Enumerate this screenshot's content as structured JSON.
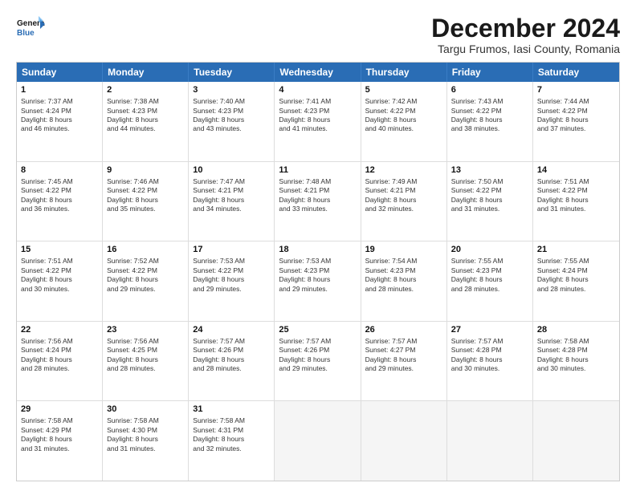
{
  "header": {
    "logo_line1": "General",
    "logo_line2": "Blue",
    "title": "December 2024",
    "subtitle": "Targu Frumos, Iasi County, Romania"
  },
  "days": [
    "Sunday",
    "Monday",
    "Tuesday",
    "Wednesday",
    "Thursday",
    "Friday",
    "Saturday"
  ],
  "rows": [
    [
      {
        "day": "1",
        "info": "Sunrise: 7:37 AM\nSunset: 4:24 PM\nDaylight: 8 hours\nand 46 minutes."
      },
      {
        "day": "2",
        "info": "Sunrise: 7:38 AM\nSunset: 4:23 PM\nDaylight: 8 hours\nand 44 minutes."
      },
      {
        "day": "3",
        "info": "Sunrise: 7:40 AM\nSunset: 4:23 PM\nDaylight: 8 hours\nand 43 minutes."
      },
      {
        "day": "4",
        "info": "Sunrise: 7:41 AM\nSunset: 4:23 PM\nDaylight: 8 hours\nand 41 minutes."
      },
      {
        "day": "5",
        "info": "Sunrise: 7:42 AM\nSunset: 4:22 PM\nDaylight: 8 hours\nand 40 minutes."
      },
      {
        "day": "6",
        "info": "Sunrise: 7:43 AM\nSunset: 4:22 PM\nDaylight: 8 hours\nand 38 minutes."
      },
      {
        "day": "7",
        "info": "Sunrise: 7:44 AM\nSunset: 4:22 PM\nDaylight: 8 hours\nand 37 minutes."
      }
    ],
    [
      {
        "day": "8",
        "info": "Sunrise: 7:45 AM\nSunset: 4:22 PM\nDaylight: 8 hours\nand 36 minutes."
      },
      {
        "day": "9",
        "info": "Sunrise: 7:46 AM\nSunset: 4:22 PM\nDaylight: 8 hours\nand 35 minutes."
      },
      {
        "day": "10",
        "info": "Sunrise: 7:47 AM\nSunset: 4:21 PM\nDaylight: 8 hours\nand 34 minutes."
      },
      {
        "day": "11",
        "info": "Sunrise: 7:48 AM\nSunset: 4:21 PM\nDaylight: 8 hours\nand 33 minutes."
      },
      {
        "day": "12",
        "info": "Sunrise: 7:49 AM\nSunset: 4:21 PM\nDaylight: 8 hours\nand 32 minutes."
      },
      {
        "day": "13",
        "info": "Sunrise: 7:50 AM\nSunset: 4:22 PM\nDaylight: 8 hours\nand 31 minutes."
      },
      {
        "day": "14",
        "info": "Sunrise: 7:51 AM\nSunset: 4:22 PM\nDaylight: 8 hours\nand 31 minutes."
      }
    ],
    [
      {
        "day": "15",
        "info": "Sunrise: 7:51 AM\nSunset: 4:22 PM\nDaylight: 8 hours\nand 30 minutes."
      },
      {
        "day": "16",
        "info": "Sunrise: 7:52 AM\nSunset: 4:22 PM\nDaylight: 8 hours\nand 29 minutes."
      },
      {
        "day": "17",
        "info": "Sunrise: 7:53 AM\nSunset: 4:22 PM\nDaylight: 8 hours\nand 29 minutes."
      },
      {
        "day": "18",
        "info": "Sunrise: 7:53 AM\nSunset: 4:23 PM\nDaylight: 8 hours\nand 29 minutes."
      },
      {
        "day": "19",
        "info": "Sunrise: 7:54 AM\nSunset: 4:23 PM\nDaylight: 8 hours\nand 28 minutes."
      },
      {
        "day": "20",
        "info": "Sunrise: 7:55 AM\nSunset: 4:23 PM\nDaylight: 8 hours\nand 28 minutes."
      },
      {
        "day": "21",
        "info": "Sunrise: 7:55 AM\nSunset: 4:24 PM\nDaylight: 8 hours\nand 28 minutes."
      }
    ],
    [
      {
        "day": "22",
        "info": "Sunrise: 7:56 AM\nSunset: 4:24 PM\nDaylight: 8 hours\nand 28 minutes."
      },
      {
        "day": "23",
        "info": "Sunrise: 7:56 AM\nSunset: 4:25 PM\nDaylight: 8 hours\nand 28 minutes."
      },
      {
        "day": "24",
        "info": "Sunrise: 7:57 AM\nSunset: 4:26 PM\nDaylight: 8 hours\nand 28 minutes."
      },
      {
        "day": "25",
        "info": "Sunrise: 7:57 AM\nSunset: 4:26 PM\nDaylight: 8 hours\nand 29 minutes."
      },
      {
        "day": "26",
        "info": "Sunrise: 7:57 AM\nSunset: 4:27 PM\nDaylight: 8 hours\nand 29 minutes."
      },
      {
        "day": "27",
        "info": "Sunrise: 7:57 AM\nSunset: 4:28 PM\nDaylight: 8 hours\nand 30 minutes."
      },
      {
        "day": "28",
        "info": "Sunrise: 7:58 AM\nSunset: 4:28 PM\nDaylight: 8 hours\nand 30 minutes."
      }
    ],
    [
      {
        "day": "29",
        "info": "Sunrise: 7:58 AM\nSunset: 4:29 PM\nDaylight: 8 hours\nand 31 minutes."
      },
      {
        "day": "30",
        "info": "Sunrise: 7:58 AM\nSunset: 4:30 PM\nDaylight: 8 hours\nand 31 minutes."
      },
      {
        "day": "31",
        "info": "Sunrise: 7:58 AM\nSunset: 4:31 PM\nDaylight: 8 hours\nand 32 minutes."
      },
      {
        "day": "",
        "info": ""
      },
      {
        "day": "",
        "info": ""
      },
      {
        "day": "",
        "info": ""
      },
      {
        "day": "",
        "info": ""
      }
    ]
  ]
}
